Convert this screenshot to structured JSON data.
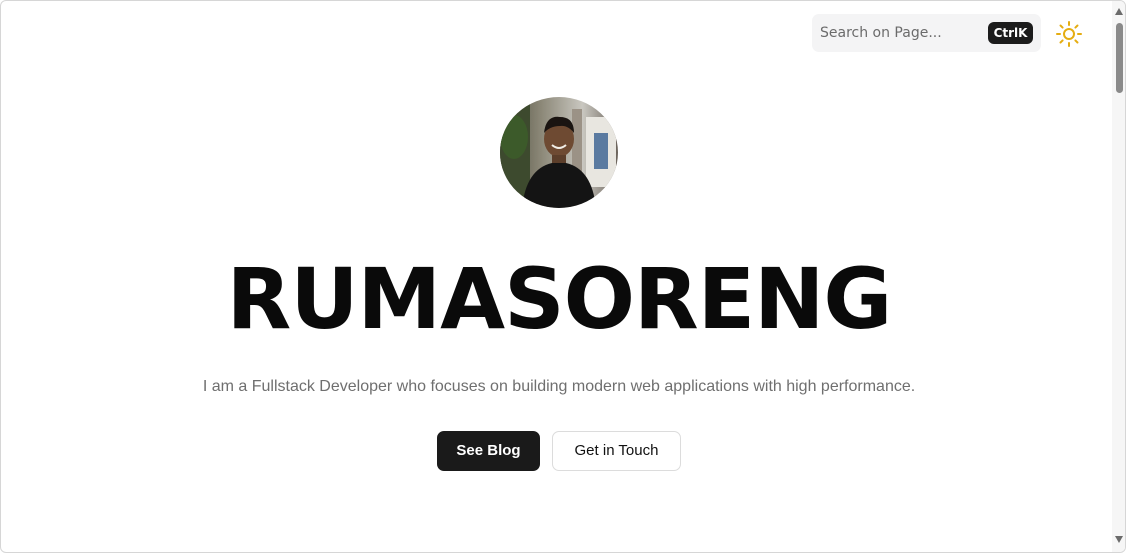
{
  "header": {
    "search_placeholder": "Search on Page...",
    "search_shortcut": "CtrlK",
    "theme_icon": "sun-icon",
    "theme_icon_color": "#e5ad12"
  },
  "hero": {
    "avatar_icon": "profile-photo",
    "name": "RUMASORENG",
    "tagline": "I am a Fullstack Developer who focuses on building modern web applications with high performance.",
    "primary_button": "See Blog",
    "secondary_button": "Get in Touch"
  },
  "colors": {
    "primary_button_bg": "#1a1a1a",
    "title_color": "#0a0a0a",
    "tagline_color": "#6f6f6f"
  }
}
